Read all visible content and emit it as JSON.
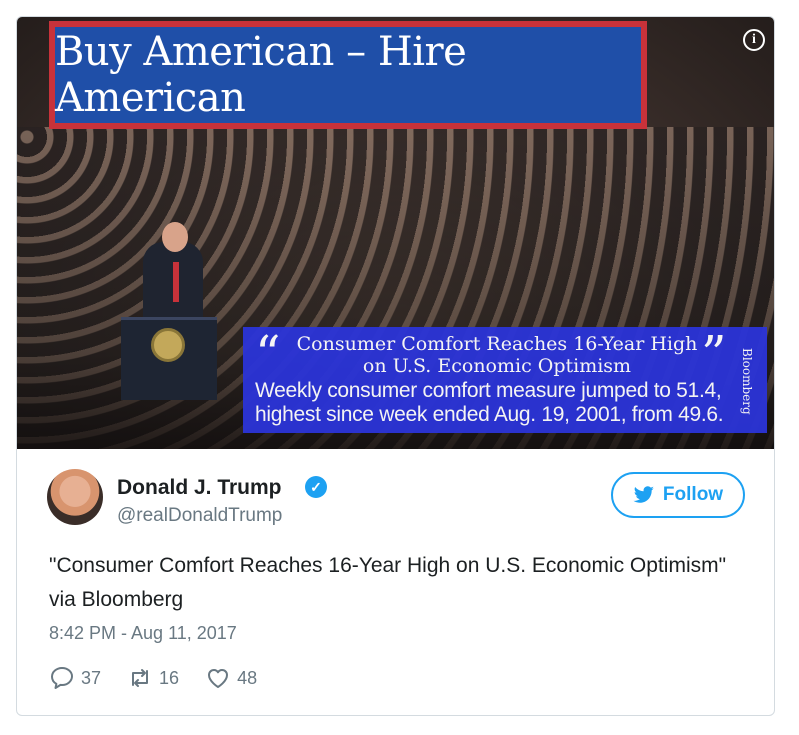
{
  "media": {
    "banner_text": "Buy American – Hire American",
    "quote_headline": "Consumer Comfort Reaches 16-Year High on U.S. Economic Optimism",
    "quote_body": "Weekly consumer comfort measure jumped to 51.4, highest since week ended Aug. 19, 2001, from 49.6.",
    "quote_source": "Bloomberg",
    "info_icon": "info-icon"
  },
  "author": {
    "display_name": "Donald J. Trump",
    "handle": "@realDonaldTrump",
    "verified_icon": "verified-badge-icon"
  },
  "follow": {
    "label": "Follow",
    "icon": "twitter-bird-icon"
  },
  "tweet": {
    "text": "\"Consumer Comfort Reaches 16-Year High on U.S. Economic Optimism\" via Bloomberg",
    "timestamp": "8:42 PM - Aug 11, 2017"
  },
  "actions": {
    "replies": "37",
    "retweets": "16",
    "likes": "48"
  },
  "colors": {
    "accent": "#1da1f2",
    "banner_blue": "#1f4fa8",
    "banner_red": "#c8323a",
    "quote_blue": "#2b34d8"
  }
}
